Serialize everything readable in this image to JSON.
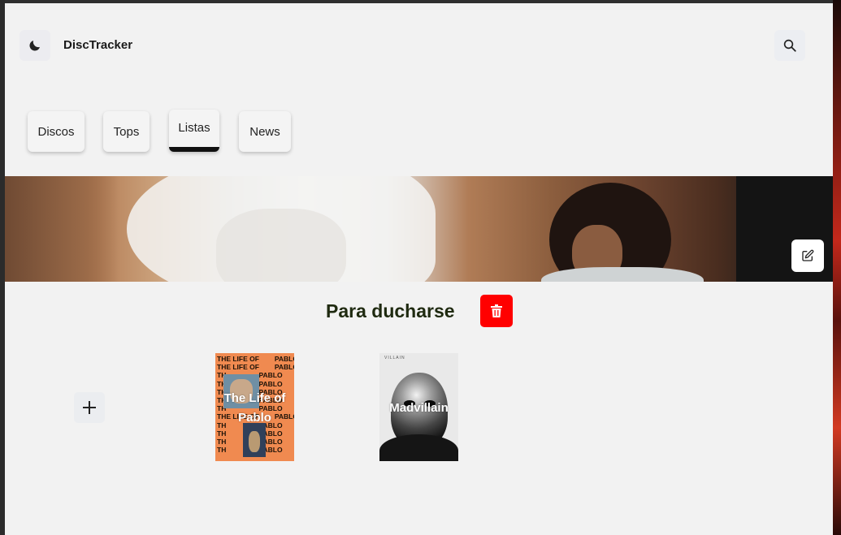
{
  "app": {
    "title": "DiscTracker"
  },
  "header": {
    "theme_icon": "moon-icon",
    "search_icon": "search-icon"
  },
  "tabs": [
    {
      "label": "Discos",
      "active": false
    },
    {
      "label": "Tops",
      "active": false
    },
    {
      "label": "Listas",
      "active": true
    },
    {
      "label": "News",
      "active": false
    }
  ],
  "list": {
    "title": "Para ducharse",
    "edit_icon": "edit-icon",
    "delete_icon": "trash-icon",
    "add_icon": "plus-icon",
    "albums": [
      {
        "title": "The Life of Pablo",
        "cover_text": "THE LIFE OF  PABLO"
      },
      {
        "title": "Madvillain",
        "cover_text": "VILLAIN"
      }
    ]
  },
  "colors": {
    "delete_button": "#ff0000",
    "active_tab_underline": "#111111",
    "app_background": "#f2f2f2"
  }
}
